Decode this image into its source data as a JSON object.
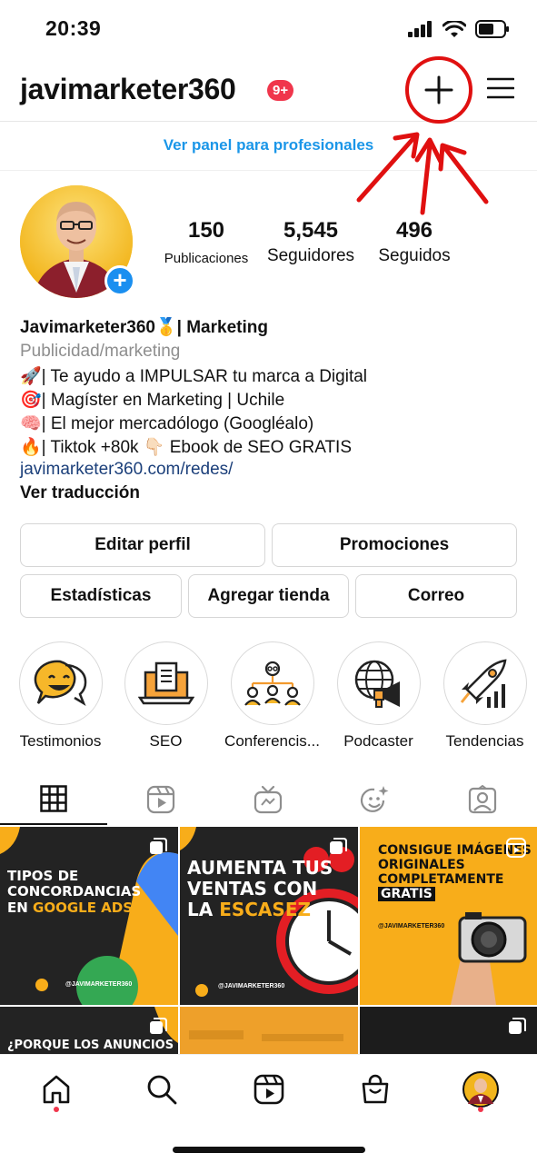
{
  "status_bar": {
    "time": "20:39"
  },
  "header": {
    "username": "javimarketer360",
    "badge": "9+",
    "create_icon": "plus-icon",
    "menu_icon": "hamburger-menu-icon"
  },
  "pro_panel": {
    "label": "Ver panel para profesionales"
  },
  "stats": {
    "posts": {
      "value": "150",
      "label": "Publicaciones"
    },
    "followers": {
      "value": "5,545",
      "label": "Seguidores"
    },
    "following": {
      "value": "496",
      "label": "Seguidos"
    }
  },
  "bio": {
    "name": "Javimarketer360🥇| Marketing",
    "category": "Publicidad/marketing",
    "lines": [
      "🚀| Te ayudo a IMPULSAR tu marca a Digital",
      "🎯| Magíster en Marketing | Uchile",
      "🧠| El mejor mercadólogo (Googléalo)",
      "🔥| Tiktok +80k 👇🏻 Ebook de SEO GRATIS"
    ],
    "link": "javimarketer360.com/redes/",
    "translate": "Ver traducción"
  },
  "buttons": {
    "edit_profile": "Editar perfil",
    "promotions": "Promociones",
    "stats": "Estadísticas",
    "add_shop": "Agregar tienda",
    "email": "Correo"
  },
  "highlights": [
    {
      "label": "Testimonios",
      "icon": "speech-bubble-icon"
    },
    {
      "label": "SEO",
      "icon": "laptop-document-icon"
    },
    {
      "label": "Conferencis...",
      "icon": "team-icon"
    },
    {
      "label": "Podcaster",
      "icon": "globe-megaphone-icon"
    },
    {
      "label": "Tendencias",
      "icon": "rocket-chart-icon"
    }
  ],
  "tabs": [
    "grid-icon",
    "reels-icon",
    "igtv-icon",
    "effects-icon",
    "tagged-icon"
  ],
  "posts": [
    {
      "title_lines": [
        "Tipos de",
        "concordancias",
        "en "
      ],
      "highlight": "Google Ads",
      "handle": "@JAVIMARKETER360"
    },
    {
      "title_lines": [
        "Aumenta tus",
        "ventas con",
        "la "
      ],
      "highlight": "escasez",
      "handle": "@JAVIMARKETER360"
    },
    {
      "title_lines": [
        "Consigue imágenes",
        "originales",
        "completamente"
      ],
      "highlight": "gratis",
      "handle": "@JAVIMARKETER360"
    },
    {
      "title_lines": [
        "¿Porque los anuncios"
      ],
      "highlight": "",
      "handle": ""
    },
    {
      "title_lines": [],
      "highlight": "",
      "handle": ""
    },
    {
      "title_lines": [],
      "highlight": "",
      "handle": ""
    }
  ],
  "bottom_nav": [
    "home-icon",
    "search-icon",
    "reels-icon",
    "shop-icon",
    "profile-avatar"
  ],
  "colors": {
    "accent_blue": "#1a96e8",
    "badge_red": "#f0364c",
    "annotation_red": "#e01010",
    "post_yellow": "#f8ad1a",
    "post_dark": "#222222"
  }
}
